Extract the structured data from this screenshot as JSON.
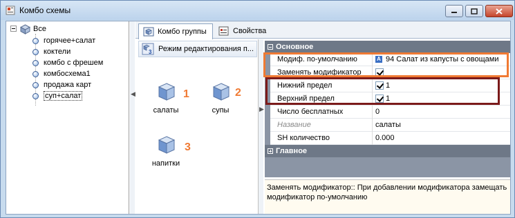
{
  "window": {
    "title": "Комбо схемы"
  },
  "tree": {
    "root": "Все",
    "items": [
      "горячее+салат",
      "коктели",
      "комбо с фрешем",
      "комбосхема1",
      "продажа карт",
      "суп+салат"
    ],
    "selected_index": 5
  },
  "tabs": [
    {
      "label": "Комбо группы",
      "icon": "combo-groups-icon",
      "active": true
    },
    {
      "label": "Свойства",
      "icon": "properties-icon",
      "active": false
    }
  ],
  "group_panel": {
    "header": "Режим редактирования п...",
    "items": [
      {
        "label": "салаты",
        "number": "1"
      },
      {
        "label": "супы",
        "number": "2"
      },
      {
        "label": "напитки",
        "number": "3"
      }
    ]
  },
  "properties": {
    "category_main": "Основное",
    "category_general": "Главное",
    "rows": [
      {
        "name": "Модиф. по-умолчанию",
        "value": "94 Салат из капусты с овощами",
        "type": "icon-text"
      },
      {
        "name": "Заменять модификатор",
        "value": "",
        "type": "check"
      },
      {
        "name": "Нижний предел",
        "value": "1",
        "type": "check"
      },
      {
        "name": "Верхний предел",
        "value": "1",
        "type": "check"
      },
      {
        "name": "Число бесплатных",
        "value": "0",
        "type": "text"
      },
      {
        "name": "Название",
        "value": "салаты",
        "type": "text-disabled"
      },
      {
        "name": "SH количество",
        "value": "0.000",
        "type": "text"
      }
    ],
    "value_icon_letter": "A"
  },
  "description": "Заменять модификатор:: При добавлении модификатора замещать модификатор по-умолчанию",
  "colors": {
    "highlight_orange": "#f07a33",
    "highlight_dark": "#7b1a1a",
    "number": "#f07a33"
  }
}
